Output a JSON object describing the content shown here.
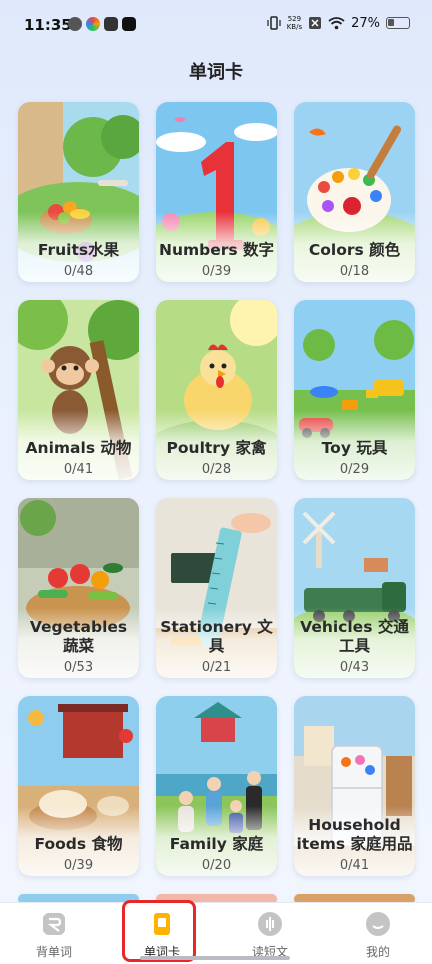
{
  "status_bar": {
    "time": "11:35",
    "net_speed_value": "529",
    "net_speed_unit": "KB/s",
    "battery": "27%"
  },
  "page_title": "单词卡",
  "cards": [
    {
      "title": "Fruits水果",
      "progress": "0/48",
      "theme": "fruits"
    },
    {
      "title": "Numbers 数字",
      "progress": "0/39",
      "theme": "numbers"
    },
    {
      "title": "Colors 颜色",
      "progress": "0/18",
      "theme": "colors"
    },
    {
      "title": "Animals 动物",
      "progress": "0/41",
      "theme": "animals"
    },
    {
      "title": "Poultry 家禽",
      "progress": "0/28",
      "theme": "poultry"
    },
    {
      "title": "Toy 玩具",
      "progress": "0/29",
      "theme": "toy"
    },
    {
      "title": "Vegetables 蔬菜",
      "progress": "0/53",
      "theme": "vegetables"
    },
    {
      "title": "Stationery 文具",
      "progress": "0/21",
      "theme": "stationery"
    },
    {
      "title": "Vehicles 交通工具",
      "progress": "0/43",
      "theme": "vehicles"
    },
    {
      "title": "Foods 食物",
      "progress": "0/39",
      "theme": "foods"
    },
    {
      "title": "Family 家庭",
      "progress": "0/20",
      "theme": "family"
    },
    {
      "title": "Household items 家庭用品",
      "progress": "0/41",
      "theme": "household"
    }
  ],
  "bottom_nav": [
    {
      "label": "背单词",
      "icon": "memorize-icon",
      "active": false
    },
    {
      "label": "单词卡",
      "icon": "flashcard-icon",
      "active": true
    },
    {
      "label": "读短文",
      "icon": "audio-icon",
      "active": false
    },
    {
      "label": "我的",
      "icon": "profile-icon",
      "active": false
    }
  ],
  "colors": {
    "active_icon": "#ffb300",
    "highlight": "#e52929"
  }
}
